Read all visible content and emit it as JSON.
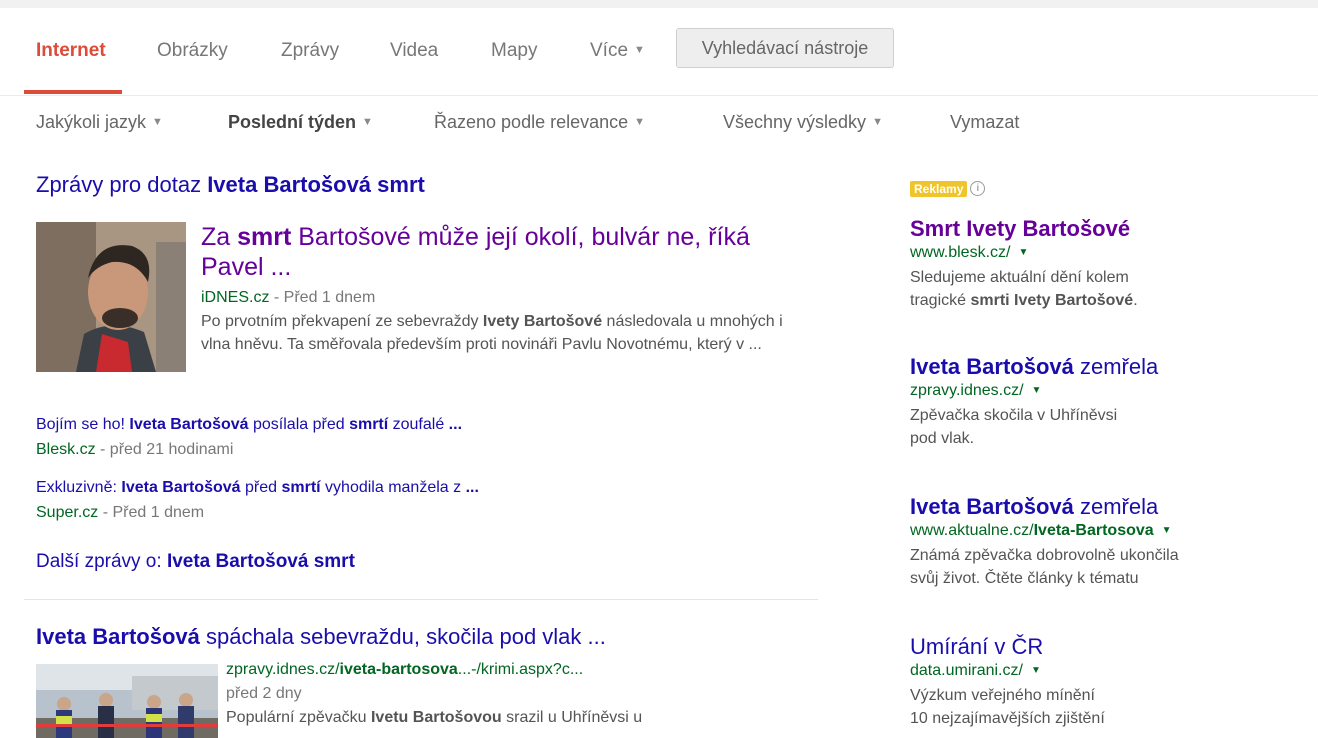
{
  "tabs": {
    "items": [
      "Internet",
      "Obrázky",
      "Zprávy",
      "Videa",
      "Mapy",
      "Více"
    ],
    "tools_label": "Vyhledávací nástroje"
  },
  "filters": {
    "language": "Jakýkoli jazyk",
    "time": "Poslední týden",
    "sort": "Řazeno podle relevance",
    "results": "Všechny výsledky",
    "clear": "Vymazat"
  },
  "news": {
    "heading_prefix": "Zprávy pro dotaz ",
    "query": "Iveta Bartošová smrt",
    "top": {
      "title_pre": "Za ",
      "title_b": "smrt",
      "title_post": " Bartošové může její okolí, bulvár ne, říká Pavel ...",
      "source": "iDNES.cz",
      "time": "Před 1 dnem",
      "snip_1": "Po prvotním překvapení ze sebevraždy ",
      "snip_b": "Ivety Bartošové",
      "snip_2": " následovala u mnohých i vlna hněvu. Ta směřovala především proti novináři Pavlu Novotnému, který v ..."
    },
    "story2": {
      "t1": "Bojím se ho! ",
      "b1": "Iveta Bartošová",
      "t2": " posílala před ",
      "b2": "smrtí",
      "t3": " zoufalé ",
      "b3": "...",
      "source": "Blesk.cz",
      "time": "před 21 hodinami"
    },
    "story3": {
      "t1": "Exkluzivně: ",
      "b1": "Iveta Bartošová",
      "t2": " před ",
      "b2": "smrtí",
      "t3": " vyhodila manžela z ",
      "b3": "...",
      "source": "Super.cz",
      "time": "Před 1 dnem"
    },
    "more_prefix": "Další zprávy o: ",
    "more_query": "Iveta Bartošová smrt"
  },
  "result2": {
    "title_b": "Iveta Bartošová",
    "title_rest": " spáchala sebevraždu, skočila pod vlak ...",
    "url_pre": "zpravy.idnes.cz/",
    "url_b": "iveta-bartosova",
    "url_post": "...-/krimi.aspx?c...",
    "date": "před 2 dny",
    "snip_1": "Populární zpěvačku ",
    "snip_b": "Ivetu Bartošovou",
    "snip_2": " srazil u Uhříněvsi u"
  },
  "ads": {
    "badge": "Reklamy",
    "info_icon": "info-circle-icon",
    "items": [
      {
        "title": "Smrt Ivety Bartošové",
        "url": "www.blesk.cz/",
        "d1": "Sledujeme aktuální dění kolem",
        "d2_pre": "tragické ",
        "d2_b": "smrti Ivety Bartošové",
        "d2_post": "."
      },
      {
        "title_b": "Iveta Bartošová",
        "title_rest": " zemřela",
        "url": "zpravy.idnes.cz/",
        "d1": "Zpěvačka skočila v Uhříněvsi",
        "d2": "pod vlak."
      },
      {
        "title_b": "Iveta Bartošová",
        "title_rest": " zemřela",
        "url_pre": "www.aktualne.cz/",
        "url_b": "Iveta-Bartosova",
        "d1": "Známá zpěvačka dobrovolně ukončila",
        "d2": "svůj život. Čtěte články k tématu"
      },
      {
        "title": "Umírání v ČR",
        "url": "data.umirani.cz/",
        "d1": "Výzkum veřejného mínění",
        "d2": "10 nejzajímavějších zjištění"
      }
    ]
  },
  "colors": {
    "link": "#1a0dab",
    "visited": "#660099",
    "url_green": "#006621",
    "active_tab": "#dd4b39",
    "ad_badge": "#f0c42b"
  },
  "icons": {
    "dropdown": "caret-down-icon"
  }
}
